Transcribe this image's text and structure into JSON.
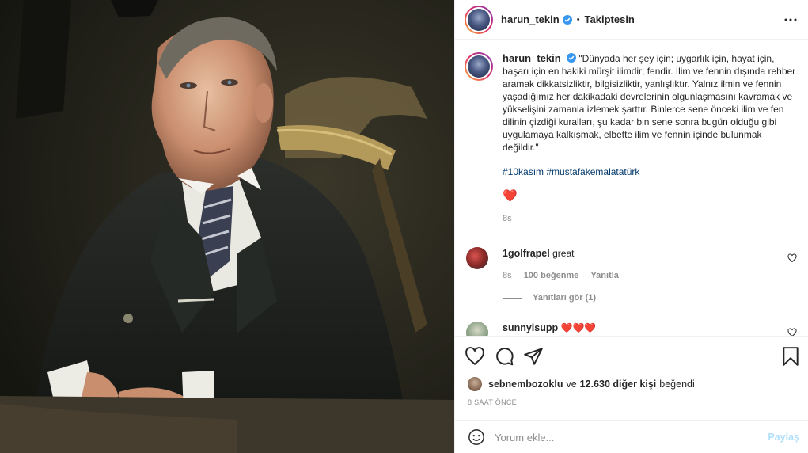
{
  "post": {
    "photo_alt": "portrait-photo",
    "author": "harun_tekin",
    "follow_status": "Takiptesin",
    "dot": "•"
  },
  "caption": {
    "author": "harun_tekin",
    "text": "\"Dünyada her şey için; uygarlık için, hayat için, başarı için en hakiki mürşit ilimdir; fendir. İlim ve fennin dışında rehber aramak dikkatsizliktir, bilgisizliktir, yanlışlıktır. Yalnız ilmin ve fennin yaşadığımız her dakikadaki devrelerinin olgunlaşmasını kavramak ve yükselişini zamanla izlemek şarttır. Binlerce sene önceki ilim ve fen dilinin çizdiği kuralları, şu kadar bin sene sonra bugün olduğu gibi uygulamaya kalkışmak, elbette ilim ve fennin içinde bulunmak değildir.\"",
    "hashtags": "#10kasım #mustafakemalatatürk",
    "emoji": "❤️",
    "time": "8s"
  },
  "comments": [
    {
      "user": "1golfrapel",
      "text": "great",
      "time": "8s",
      "likes": "100 beğenme",
      "reply": "Yanıtla",
      "replies": "Yanıtları gör (1)"
    },
    {
      "user": "sunnyisupp",
      "text": "❤️❤️❤️"
    }
  ],
  "likes": {
    "user": "sebnembozoklu",
    "and": "ve",
    "others": "12.630 diğer kişi",
    "suffix": "beğendi"
  },
  "posted_ago": "8 SAAT ÖNCE",
  "comment_box": {
    "placeholder": "Yorum ekle...",
    "share_label": "Paylaş"
  },
  "icons": {
    "like": "heart-icon",
    "comment": "comment-icon",
    "share": "paper-plane-icon",
    "save": "bookmark-icon",
    "more": "more-icon",
    "verified": "verified-badge-icon",
    "emoji": "emoji-icon"
  },
  "colors": {
    "verified": "#3897f0",
    "link": "#00376b",
    "muted": "#8e8e8e",
    "share_disabled": "#b2dffc"
  }
}
